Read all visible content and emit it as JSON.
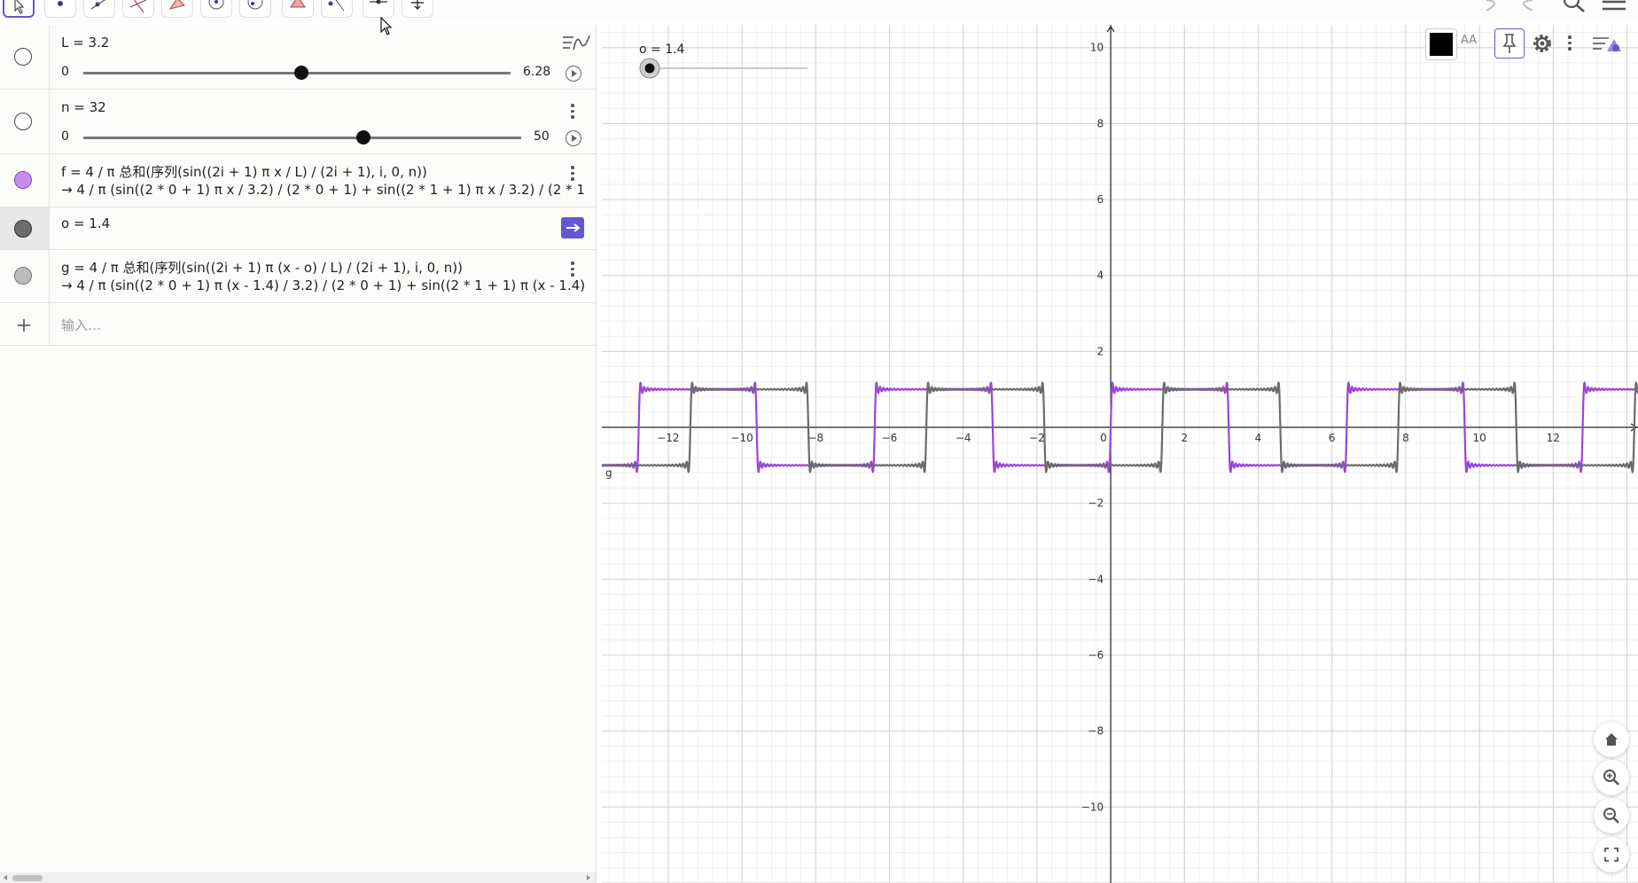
{
  "algebra": {
    "L_label": "L = 3.2",
    "L_min": "0",
    "L_max": "6.28",
    "n_label": "n = 32",
    "n_min": "0",
    "n_max": "50",
    "f_def": "f = 4 / π 总和(序列(sin((2i + 1) π x / L) / (2i + 1), i, 0, n))",
    "f_value": "→ 4 / π (sin((2 * 0 + 1) π x / 3.2) / (2 * 0 + 1) + sin((2 * 1 + 1) π x / 3.2) / (2 * 1",
    "o_label": "o = 1.4",
    "g_def": "g = 4 / π 总和(序列(sin((2i + 1) π (x - o) / L) / (2i + 1), i, 0, n))",
    "g_value": "→ 4 / π (sin((2 * 0 + 1) π (x - 1.4) / 3.2) / (2 * 0 + 1) + sin((2 * 1 + 1) π (x - 1.4)",
    "input_placeholder": "输入…"
  },
  "sliders": {
    "L": 3.2,
    "L_range": [
      0,
      6.28
    ],
    "n": 32,
    "n_range": [
      0,
      50
    ]
  },
  "graphics": {
    "o_slider_label": "o = 1.4",
    "curve_label": "g",
    "x_ticks": [
      "−12",
      "−10",
      "−8",
      "−6",
      "−4",
      "−2",
      "0",
      "2",
      "4",
      "6",
      "8",
      "10",
      "12"
    ],
    "y_ticks": [
      "10",
      "8",
      "6",
      "4",
      "2",
      "−2",
      "−4",
      "−6",
      "−8",
      "−10"
    ]
  },
  "icons": [
    "move-tool-icon",
    "point-tool-icon",
    "line-tool-icon",
    "perpendicular-tool-icon",
    "polygon-tool-icon",
    "circle-tool-icon",
    "circle-through-tool-icon",
    "angle-tool-icon",
    "reflect-tool-icon",
    "slider-tool-icon",
    "move-view-tool-icon",
    "undo-icon",
    "redo-icon",
    "search-icon",
    "menu-icon",
    "style-bar-icon",
    "color-icon",
    "text-size-icon",
    "pin-icon",
    "settings-icon",
    "more-icon",
    "home-icon",
    "zoom-in-icon",
    "zoom-out-icon",
    "fullscreen-icon",
    "add-icon"
  ],
  "colors": {
    "f": "#9c44dc",
    "g": "#6b6b6b",
    "accent": "#6557d2"
  },
  "chart_data": {
    "type": "line",
    "xlim": [
      -13.8,
      14.3
    ],
    "ylim": [
      -12,
      10.6
    ],
    "grid": true,
    "series": [
      {
        "name": "f",
        "L": 3.2,
        "n": 32,
        "offset": 0
      },
      {
        "name": "g",
        "L": 3.2,
        "n": 32,
        "offset": 1.4
      }
    ]
  }
}
